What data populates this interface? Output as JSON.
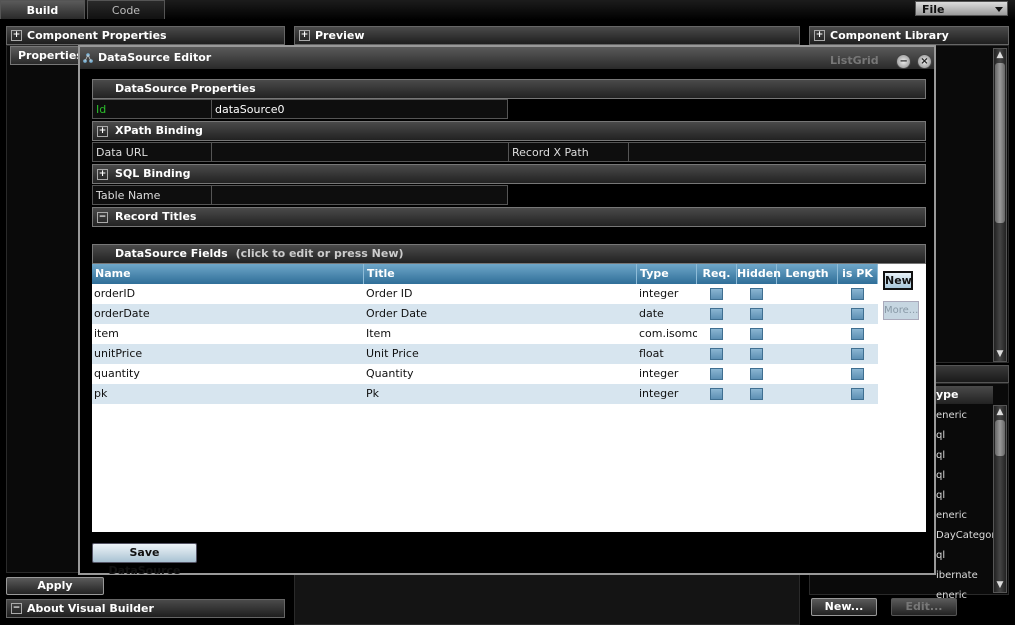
{
  "tabs": {
    "build": "Build",
    "code": "Code"
  },
  "file_menu": "File",
  "panels": {
    "component_properties": "Component Properties",
    "preview": "Preview",
    "component_library": "Component Library",
    "about": "About Visual Builder",
    "properties_tab": "Properties"
  },
  "buttons": {
    "apply": "Apply",
    "new": "New...",
    "edit": "Edit..."
  },
  "library": {
    "type_header": "ype",
    "rows": [
      "eneric",
      "ql",
      "ql",
      "ql",
      "ql",
      "eneric",
      "DayCategor",
      "ql",
      "ibernate",
      "eneric"
    ]
  },
  "modal": {
    "title": "DataSource Editor",
    "ghost_listgrid": "ListGrid",
    "sections": {
      "ds_props": "DataSource Properties",
      "xpath": "XPath Binding",
      "sql": "SQL Binding",
      "record_titles": "Record Titles",
      "fields": "DataSource Fields",
      "fields_hint": "(click to edit or press New)"
    },
    "props": {
      "id_label": "Id",
      "id_value": "dataSource0",
      "data_url_label": "Data URL",
      "data_url_value": "",
      "record_xpath_label": "Record X Path",
      "record_xpath_value": "",
      "table_name_label": "Table Name",
      "table_name_value": ""
    },
    "grid": {
      "headers": [
        "Name",
        "Title",
        "Type",
        "Req.",
        "Hidden",
        "Length",
        "is PK"
      ],
      "rows": [
        {
          "name": "orderID",
          "title": "Order ID",
          "type": "integer",
          "length": ""
        },
        {
          "name": "orderDate",
          "title": "Order Date",
          "type": "date",
          "length": ""
        },
        {
          "name": "item",
          "title": "Item",
          "type": "com.isomorphic",
          "length": ""
        },
        {
          "name": "unitPrice",
          "title": "Unit Price",
          "type": "float",
          "length": ""
        },
        {
          "name": "quantity",
          "title": "Quantity",
          "type": "integer",
          "length": ""
        },
        {
          "name": "pk",
          "title": "Pk",
          "type": "integer",
          "length": ""
        }
      ],
      "new_label": "New",
      "more_label": "More..."
    },
    "save_label": "Save DataSource"
  },
  "colors": {
    "grid_header": "#2f6e98",
    "row_alt": "#d7e5ef",
    "id_label": "#2bbf2b"
  }
}
